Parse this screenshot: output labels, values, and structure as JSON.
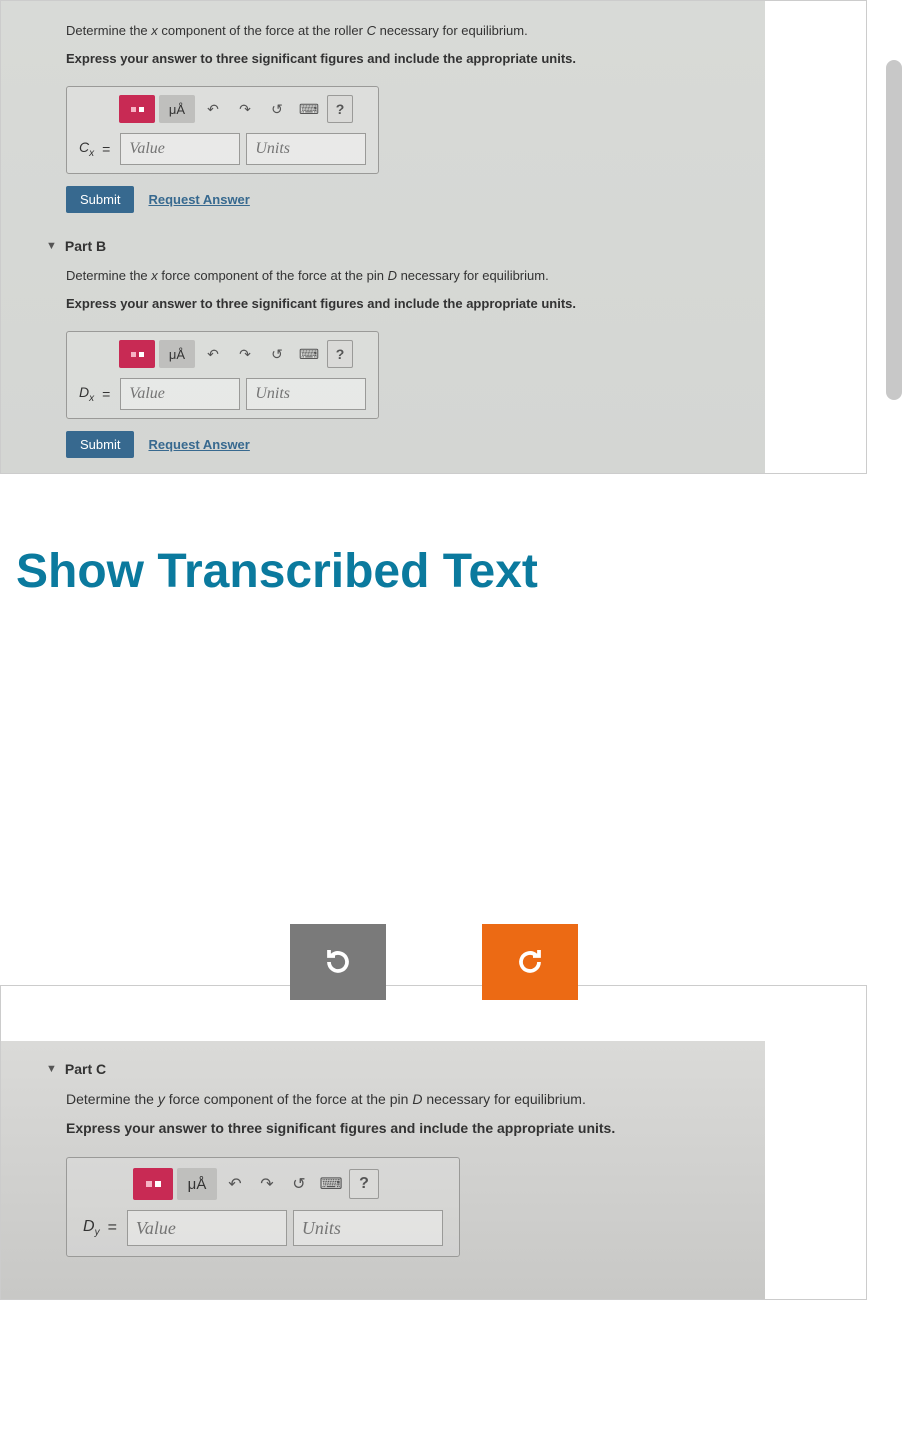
{
  "partA": {
    "prompt_prefix": "Determine the ",
    "prompt_var": "x",
    "prompt_mid": " component of the force at the roller ",
    "prompt_point": "C",
    "prompt_suffix": " necessary for equilibrium.",
    "instructions": "Express your answer to three significant figures and include the appropriate units.",
    "var_base": "C",
    "var_sub": "x",
    "value_placeholder": "Value",
    "units_placeholder": "Units",
    "submit_label": "Submit",
    "request_label": "Request Answer"
  },
  "partB": {
    "header": "Part B",
    "prompt_prefix": "Determine the ",
    "prompt_var": "x",
    "prompt_mid": " force component of the force at the pin ",
    "prompt_point": "D",
    "prompt_suffix": " necessary for equilibrium.",
    "instructions": "Express your answer to three significant figures and include the appropriate units.",
    "var_base": "D",
    "var_sub": "x",
    "value_placeholder": "Value",
    "units_placeholder": "Units",
    "submit_label": "Submit",
    "request_label": "Request Answer"
  },
  "transcribed_heading": "Show Transcribed Text",
  "partC": {
    "header": "Part C",
    "prompt_prefix": "Determine the ",
    "prompt_var": "y",
    "prompt_mid": " force component of the force at the pin ",
    "prompt_point": "D",
    "prompt_suffix": " necessary for equilibrium.",
    "instructions": "Express your answer to three significant figures and include the appropriate units.",
    "var_base": "D",
    "var_sub": "y",
    "value_placeholder": "Value",
    "units_placeholder": "Units"
  },
  "toolbar": {
    "ma_label": "μÅ",
    "help_label": "?"
  }
}
